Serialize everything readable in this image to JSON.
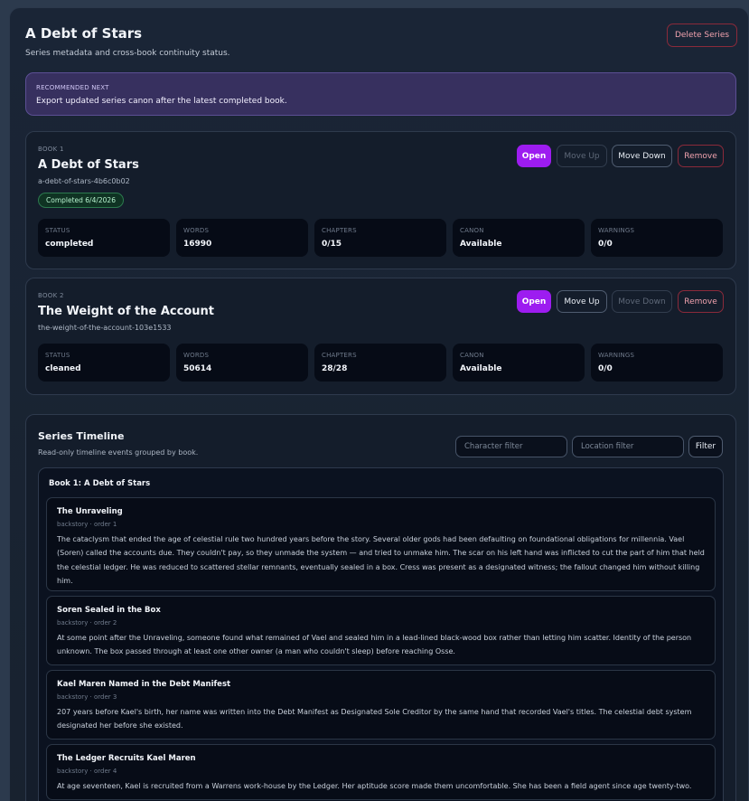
{
  "header": {
    "title": "A Debt of Stars",
    "subtitle": "Series metadata and cross-book continuity status.",
    "delete_label": "Delete Series"
  },
  "recommendation": {
    "label": "RECOMMENDED NEXT",
    "text": "Export updated series canon after the latest completed book."
  },
  "book_actions": {
    "open": "Open",
    "move_up": "Move Up",
    "move_down": "Move Down",
    "remove": "Remove"
  },
  "books": [
    {
      "number": "BOOK 1",
      "title": "A Debt of Stars",
      "slug": "a-debt-of-stars-4b6c0b02",
      "badge": "Completed 6/4/2026",
      "stats": [
        {
          "label": "STATUS",
          "value": "completed"
        },
        {
          "label": "WORDS",
          "value": "16990"
        },
        {
          "label": "CHAPTERS",
          "value": "0/15"
        },
        {
          "label": "CANON",
          "value": "Available"
        },
        {
          "label": "WARNINGS",
          "value": "0/0"
        }
      ]
    },
    {
      "number": "BOOK 2",
      "title": "The Weight of the Account",
      "slug": "the-weight-of-the-account-103e1533",
      "stats": [
        {
          "label": "STATUS",
          "value": "cleaned"
        },
        {
          "label": "WORDS",
          "value": "50614"
        },
        {
          "label": "CHAPTERS",
          "value": "28/28"
        },
        {
          "label": "CANON",
          "value": "Available"
        },
        {
          "label": "WARNINGS",
          "value": "0/0"
        }
      ]
    }
  ],
  "timeline": {
    "title": "Series Timeline",
    "subtitle": "Read-only timeline events grouped by book.",
    "character_placeholder": "Character filter",
    "location_placeholder": "Location filter",
    "filter_label": "Filter",
    "groups": [
      {
        "title": "Book 1: A Debt of Stars",
        "events": [
          {
            "title": "The Unraveling",
            "meta": "backstory · order 1",
            "description": "The cataclysm that ended the age of celestial rule two hundred years before the story. Several older gods had been defaulting on foundational obligations for millennia. Vael (Soren) called the accounts due. They couldn't pay, so they unmade the system — and tried to unmake him. The scar on his left hand was inflicted to cut the part of him that held the celestial ledger. He was reduced to scattered stellar remnants, eventually sealed in a box. Cress was present as a designated witness; the fallout changed him without killing him."
          },
          {
            "title": "Soren Sealed in the Box",
            "meta": "backstory · order 2",
            "description": "At some point after the Unraveling, someone found what remained of Vael and sealed him in a lead-lined black-wood box rather than letting him scatter. Identity of the person unknown. The box passed through at least one other owner (a man who couldn't sleep) before reaching Osse."
          },
          {
            "title": "Kael Maren Named in the Debt Manifest",
            "meta": "backstory · order 3",
            "description": "207 years before Kael's birth, her name was written into the Debt Manifest as Designated Sole Creditor by the same hand that recorded Vael's titles. The celestial debt system designated her before she existed."
          },
          {
            "title": "The Ledger Recruits Kael Maren",
            "meta": "backstory · order 4",
            "description": "At age seventeen, Kael is recruited from a Warrens work-house by the Ledger. Her aptitude score made them uncomfortable. She has been a field agent since age twenty-two."
          }
        ]
      }
    ]
  },
  "colors": {
    "accent": "#9d1cf0",
    "danger": "#f1a2ae",
    "success_badge": "#b7f3cf",
    "recommend_bg": "#37305f"
  }
}
